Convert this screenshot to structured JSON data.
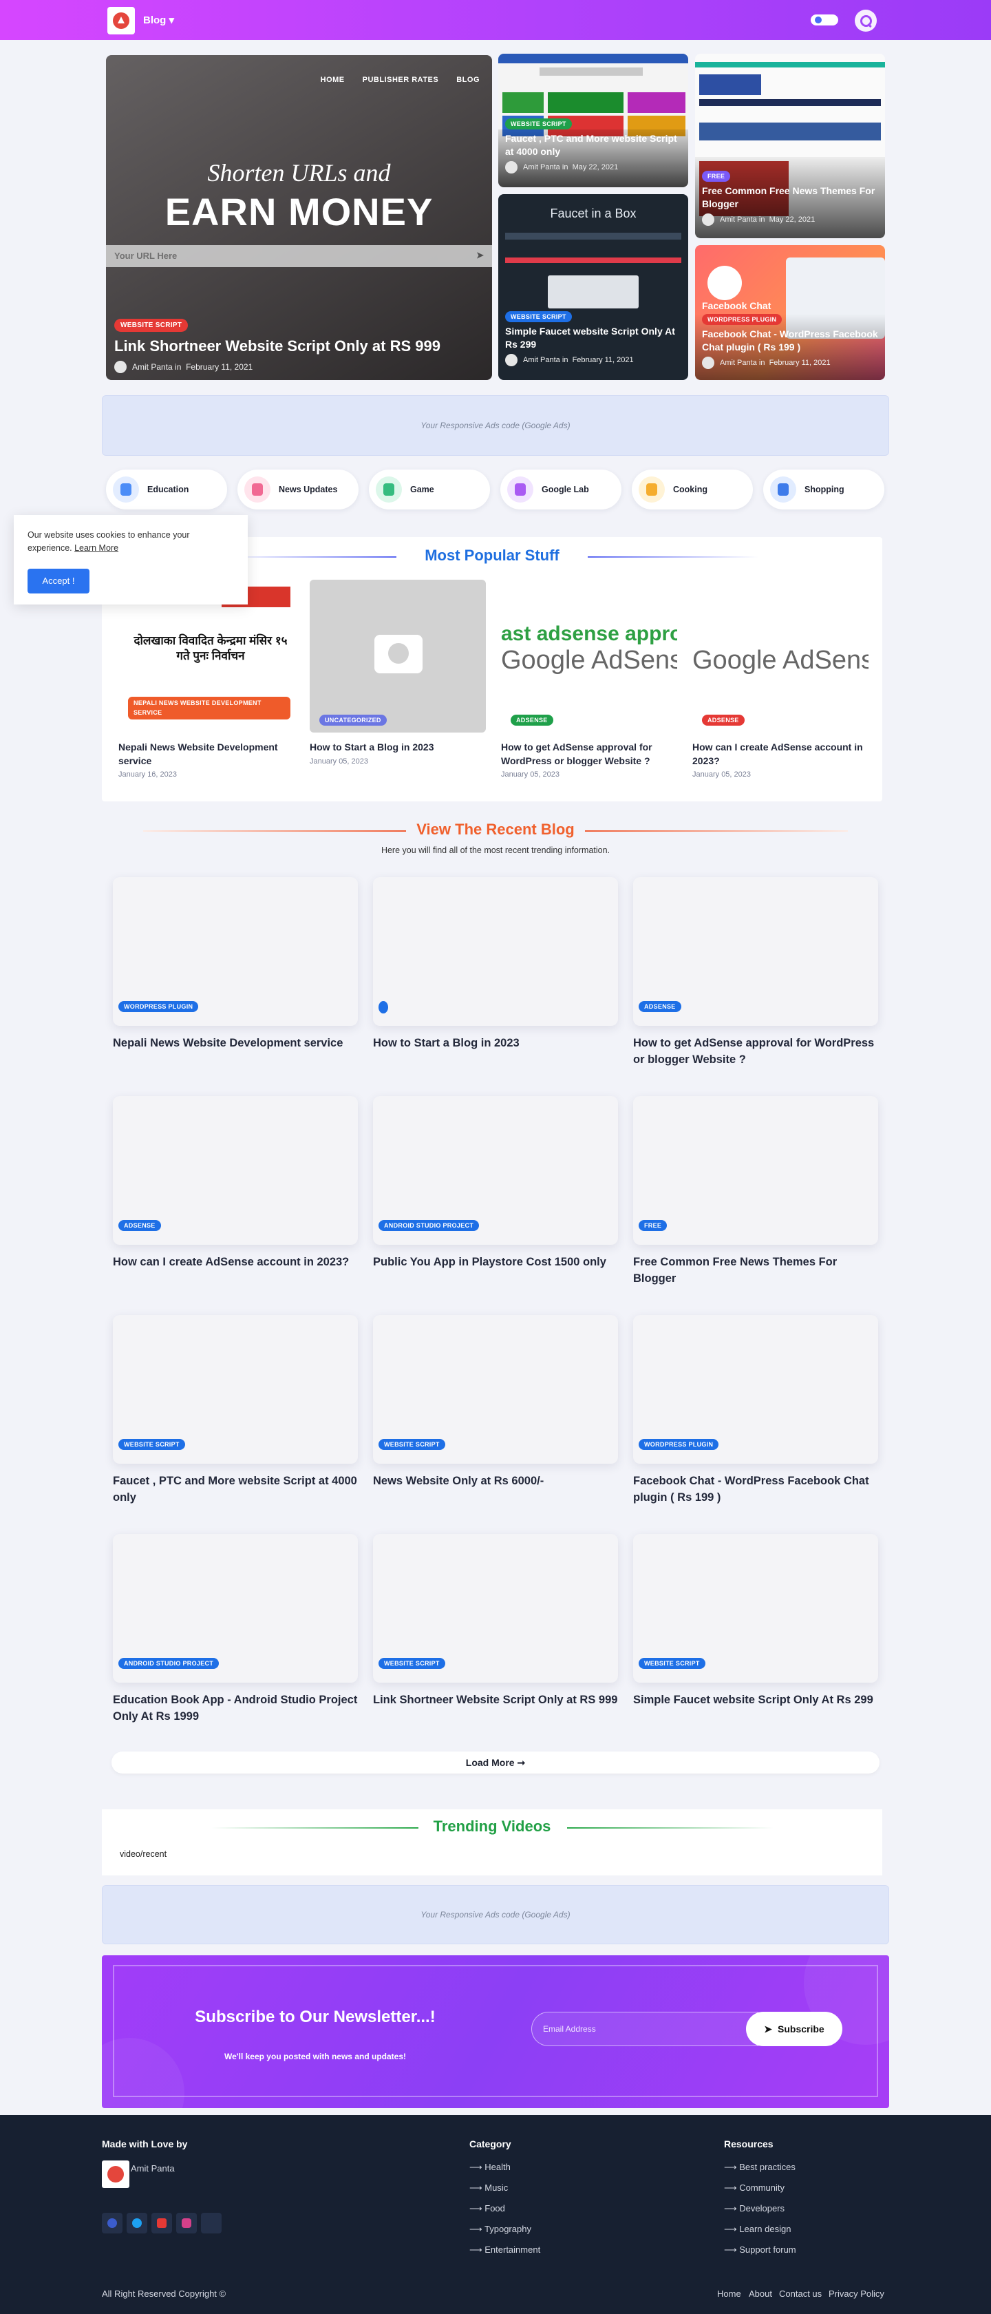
{
  "header": {
    "menu_label": "Blog ▾"
  },
  "hero": {
    "main": {
      "nav": [
        "HOME",
        "PUBLISHER RATES",
        "BLOG"
      ],
      "line1": "Shorten URLs and",
      "line2": "EARN MONEY",
      "url_placeholder": "Your URL Here",
      "badge": "WEBSITE SCRIPT",
      "title": "Link Shortneer Website Script Only at RS 999",
      "author": "Amit Panta",
      "date": "February 11, 2021"
    },
    "cards": [
      {
        "badge": "WEBSITE SCRIPT",
        "title": "Faucet , PTC and More website Script at 4000 only",
        "author": "Amit Panta",
        "date": "May 22, 2021"
      },
      {
        "badge": "FREE",
        "title": "Free Common Free News Themes For Blogger",
        "author": "Amit Panta",
        "date": "May 22, 2021"
      },
      {
        "badge": "WEBSITE SCRIPT",
        "title": "Simple Faucet website Script Only At Rs 299",
        "author": "Amit Panta",
        "date": "February 11, 2021",
        "image_text": "Faucet in a Box"
      },
      {
        "badge": "WORDPRESS PLUGIN",
        "title": "Facebook Chat - WordPress Facebook Chat plugin ( Rs 199 )",
        "author": "Amit Panta",
        "date": "February 11, 2021",
        "image_text": "Facebook Chat"
      }
    ],
    "meta_in": "in"
  },
  "ads": {
    "text": "Your Responsive Ads code (Google Ads)"
  },
  "categories": [
    {
      "label": "Education",
      "icon": "book-icon"
    },
    {
      "label": "News Updates",
      "icon": "newspaper-icon"
    },
    {
      "label": "Game",
      "icon": "gamepad-icon"
    },
    {
      "label": "Google Lab",
      "icon": "flask-icon"
    },
    {
      "label": "Cooking",
      "icon": "utensils-icon"
    },
    {
      "label": "Shopping",
      "icon": "bag-icon"
    }
  ],
  "popular": {
    "heading": "Most Popular Stuff",
    "items": [
      {
        "badge": "NEPALI NEWS WEBSITE DEVELOPMENT SERVICE",
        "title": "Nepali News Website Development service",
        "date": "January 16, 2023",
        "image_text": "दोलखाका विवादित केन्द्रमा मंसिर १५ गते पुनः निर्वाचन"
      },
      {
        "badge": "UNCATEGORIZED",
        "title": "How to Start a Blog in 2023",
        "date": "January 05, 2023"
      },
      {
        "badge": "ADSENSE",
        "title": "How to get AdSense approval for WordPress or blogger Website ?",
        "date": "January 05, 2023",
        "image_text_top": "ast adsense approval",
        "image_text": "Google AdSense"
      },
      {
        "badge": "ADSENSE",
        "title": "How can I create AdSense account in 2023?",
        "date": "January 05, 2023",
        "image_text": "Google AdSense"
      }
    ]
  },
  "recent": {
    "heading": "View The Recent Blog",
    "subheading": "Here you will find all of the most recent trending information.",
    "items": [
      {
        "badge": "WORDPRESS PLUGIN",
        "title": "Nepali News Website Development service"
      },
      {
        "badge": "",
        "title": "How to Start a Blog in 2023"
      },
      {
        "badge": "ADSENSE",
        "title": "How to get AdSense approval for WordPress or blogger Website ?"
      },
      {
        "badge": "ADSENSE",
        "title": "How can I create AdSense account in 2023?"
      },
      {
        "badge": "ANDROID STUDIO PROJECT",
        "title": "Public You App in Playstore Cost 1500 only"
      },
      {
        "badge": "FREE",
        "title": "Free Common Free News Themes For Blogger"
      },
      {
        "badge": "WEBSITE SCRIPT",
        "title": "Faucet , PTC and More website Script at 4000 only"
      },
      {
        "badge": "WEBSITE SCRIPT",
        "title": "News Website Only at Rs 6000/-"
      },
      {
        "badge": "WORDPRESS PLUGIN",
        "title": "Facebook Chat - WordPress Facebook Chat plugin ( Rs 199 )"
      },
      {
        "badge": "ANDROID STUDIO PROJECT",
        "title": "Education Book App - Android Studio Project Only At Rs 1999"
      },
      {
        "badge": "WEBSITE SCRIPT",
        "title": "Link Shortneer Website Script Only at RS 999"
      },
      {
        "badge": "WEBSITE SCRIPT",
        "title": "Simple Faucet website Script Only At Rs 299"
      }
    ],
    "load_more": "Load More ➞"
  },
  "trending": {
    "heading": "Trending Videos",
    "path": "video/recent"
  },
  "newsletter": {
    "title": "Subscribe to Our Newsletter...!",
    "subtitle": "We'll keep you posted with news and updates!",
    "email_placeholder": "Email Address",
    "button": "Subscribe"
  },
  "footer": {
    "made_with": "Made with Love by",
    "author": "Amit Panta",
    "category_heading": "Category",
    "categories": [
      "Health",
      "Music",
      "Food",
      "Typography",
      "Entertainment"
    ],
    "resources_heading": "Resources",
    "resources": [
      "Best practices",
      "Community",
      "Developers",
      "Learn design",
      "Support forum"
    ],
    "copyright": "All Right Reserved Copyright ©",
    "links": [
      "Home",
      "About",
      "Contact us",
      "Privacy Policy"
    ]
  },
  "cookie": {
    "text": "Our website uses cookies to enhance your experience.",
    "learn_more": "Learn More",
    "accept": "Accept !"
  }
}
